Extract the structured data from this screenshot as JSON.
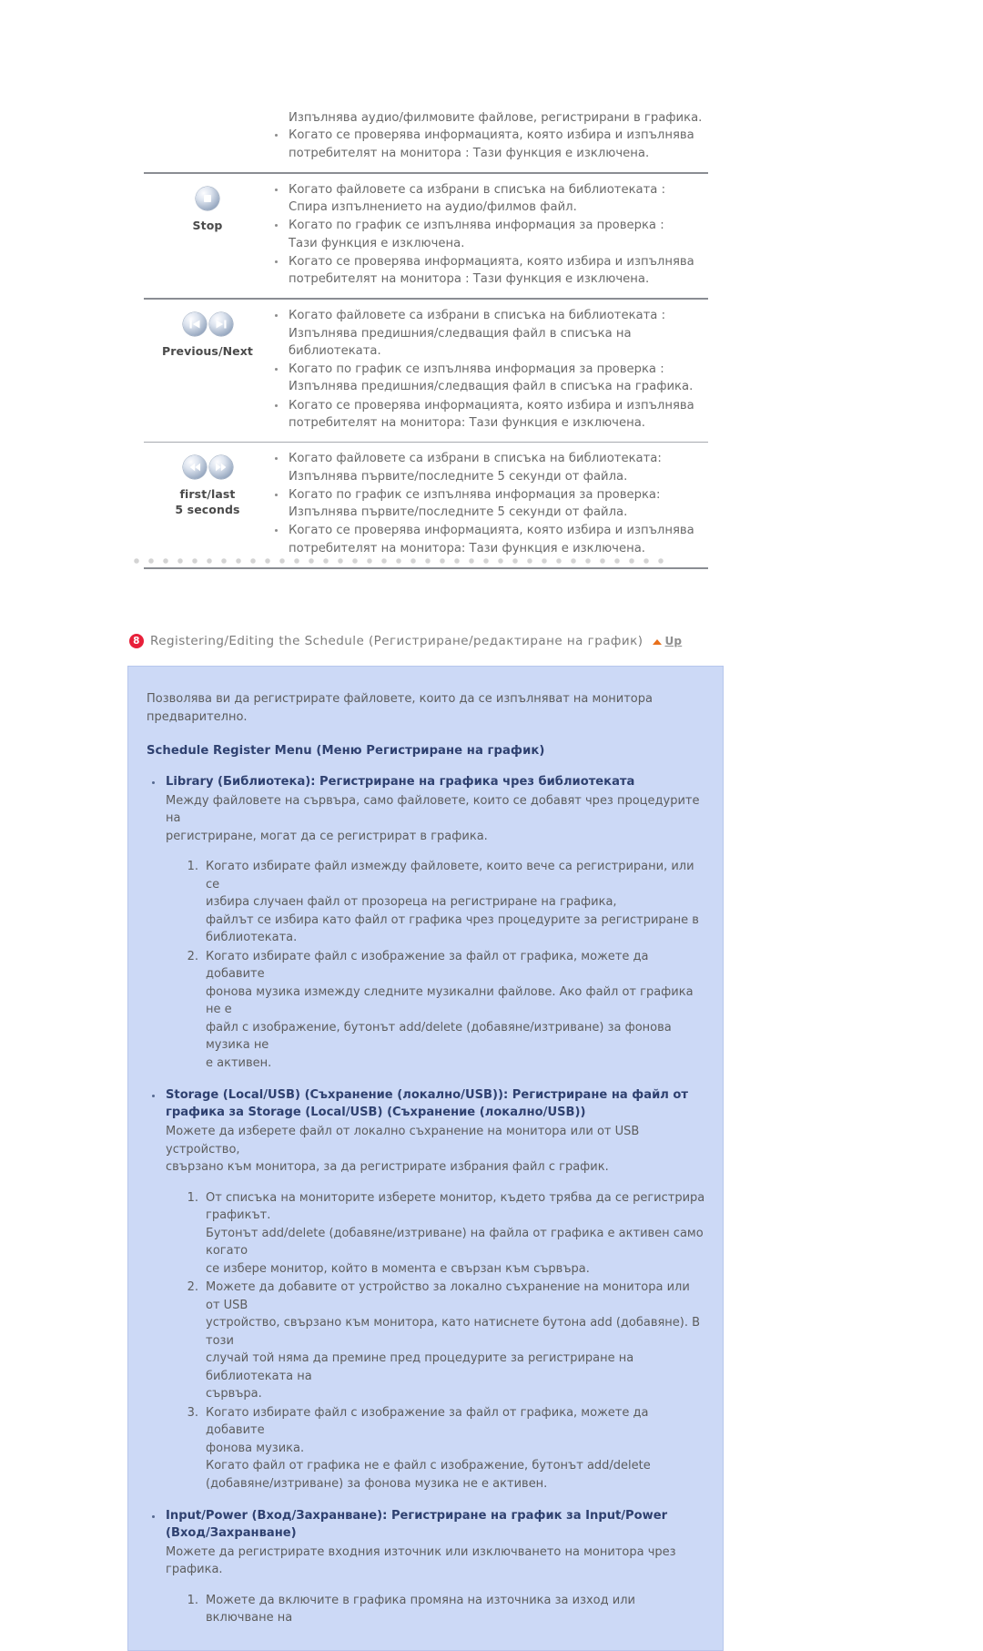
{
  "feature_table": {
    "rows": [
      {
        "icon": "none",
        "label": "",
        "lead_text": "Изпълнява аудио/филмовите файлове, регистрирани в графика.",
        "bullets": [
          [
            "Когато се проверява информацията, която избира и изпълнява",
            "потребителят на монитора : Тази функция е изключена."
          ]
        ]
      },
      {
        "icon": "stop-icon",
        "label": "Stop",
        "lead_text": "",
        "bullets": [
          [
            "Когато файловете са избрани в списъка на библиотеката :",
            "Спира изпълнението на аудио/филмов файл."
          ],
          [
            "Когато по график се изпълнява информация за проверка :",
            "Тази функция е изключена."
          ],
          [
            "Когато се проверява информацията, която избира и изпълнява",
            "потребителят на монитора : Тази функция е изключена."
          ]
        ]
      },
      {
        "icon": "previous-next-icon",
        "label": "Previous/Next",
        "lead_text": "",
        "bullets": [
          [
            "Когато файловете са избрани в списъка на библиотеката :",
            "Изпълнява предишния/следващия файл в списъка на библиотеката."
          ],
          [
            "Когато по график се изпълнява информация за проверка :",
            "Изпълнява предишния/следващия файл в списъка на графика."
          ],
          [
            "Когато се проверява информацията, която избира и изпълнява",
            "потребителят на монитора: Тази функция е изключена."
          ]
        ]
      },
      {
        "icon": "first-last-icon",
        "label": "first/last\n5 seconds",
        "label_line1": "first/last",
        "label_line2": "5 seconds",
        "lead_text": "",
        "bullets": [
          [
            "Когато файловете са избрани в списъка на библиотеката:",
            "Изпълнява първите/последните 5 секунди от файла."
          ],
          [
            "Когато по график се изпълнява информация за проверка:",
            "Изпълнява първите/последните 5 секунди от файла."
          ],
          [
            "Когато се проверява информацията, която избира и изпълнява",
            "потребителят на монитора: Тази функция е изключена."
          ]
        ]
      }
    ]
  },
  "section": {
    "number": "8",
    "title": "Registering/Editing the Schedule (Регистриране/редактиране на график)",
    "up_label": "Up"
  },
  "panel": {
    "intro": "Позволява ви да регистрирате файловете, които да се изпълняват на монитора предварително.",
    "menu_title": "Schedule Register Menu (Меню Регистриране на график)",
    "topics": [
      {
        "title": "Library (Библиотека): Регистриране на графика чрез библиотеката",
        "desc_lines": [
          "Между файловете на сървъра, само файловете, които се добавят чрез процедурите на",
          "регистриране, могат да се регистрират в графика."
        ],
        "steps": [
          [
            "Когато избирате файл измежду файловете, които вече са регистрирани, или се",
            "избира случаен файл от прозореца на регистриране на графика,",
            "файлът се избира като файл от графика чрез процедурите за регистриране в",
            "библиотеката."
          ],
          [
            "Когато избирате файл с изображение за файл от графика, можете да добавите",
            "фонова музика измежду следните музикални файлове. Ако файл от графика не е",
            "файл с изображение, бутонът add/delete (добавяне/изтриване) за фонова музика не",
            "е активен."
          ]
        ]
      },
      {
        "title": "Storage (Local/USB) (Съхранение (локално/USB)): Регистриране на файл от графика за Storage (Local/USB) (Съхранение (локално/USB))",
        "title_line1": "Storage (Local/USB) (Съхранение (локално/USB)): Регистриране на файл от",
        "title_line2": "графика за Storage (Local/USB) (Съхранение (локално/USB))",
        "desc_lines": [
          "Можете да изберете файл от локално съхранение на монитора или от USB устройство,",
          "свързано към монитора, за да регистрирате избрания файл с график."
        ],
        "steps": [
          [
            "От списъка на мониторите изберете монитор, където трябва да се регистрира",
            "графикът.",
            "Бутонът add/delete (добавяне/изтриване) на файла от графика е активен само когато",
            "се избере монитор, който в момента е свързан към сървъра."
          ],
          [
            "Можете да добавите от устройство за локално съхранение на монитора или от USB",
            "устройство, свързано към монитора, като натиснете бутона add (добавяне). В този",
            "случай той няма да премине пред процедурите за регистриране на библиотеката на",
            "сървъра."
          ],
          [
            "Когато избирате файл с изображение за файл от графика, можете да добавите",
            "фонова музика.",
            "Когато файл от графика не е файл с изображение, бутонът add/delete",
            "(добавяне/изтриване) за фонова музика не е активен."
          ]
        ]
      },
      {
        "title": "Input/Power (Вход/Захранване): Регистриране на график за Input/Power (Вход/Захранване)",
        "title_line1": "Input/Power (Вход/Захранване): Регистриране на график за Input/Power",
        "title_line2": "(Вход/Захранване)",
        "desc_lines": [
          "Можете да регистрирате входния източник или изключването на монитора чрез графика."
        ],
        "steps": [
          [
            "Можете да включите в графика промяна на източника за изход или включване на"
          ]
        ]
      }
    ]
  },
  "colors": {
    "panel_bg": "#ccd9f6",
    "panel_border": "#b7c6ec",
    "heading_blue": "#2f4170",
    "badge_red": "#e8203a",
    "up_arrow_orange": "#e8701c",
    "body_gray": "#5d5d5d",
    "rule_gray": "#8a8d93"
  }
}
